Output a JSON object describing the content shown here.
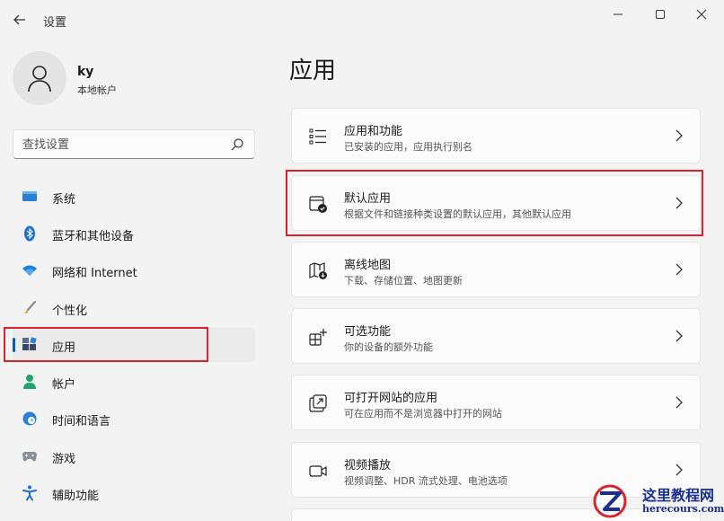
{
  "window": {
    "title": "设置",
    "back_icon": "arrow-left-icon",
    "controls": [
      "minimize-icon",
      "maximize-icon",
      "close-icon"
    ]
  },
  "profile": {
    "name": "ky",
    "account_type": "本地帐户"
  },
  "search": {
    "placeholder": "查找设置"
  },
  "nav": {
    "items": [
      {
        "label": "系统",
        "icon": "monitor-icon"
      },
      {
        "label": "蓝牙和其他设备",
        "icon": "bluetooth-icon"
      },
      {
        "label": "网络和 Internet",
        "icon": "wifi-icon"
      },
      {
        "label": "个性化",
        "icon": "brush-icon"
      },
      {
        "label": "应用",
        "icon": "apps-icon",
        "active": true
      },
      {
        "label": "帐户",
        "icon": "person-icon"
      },
      {
        "label": "时间和语言",
        "icon": "globe-clock-icon"
      },
      {
        "label": "游戏",
        "icon": "gamepad-icon"
      },
      {
        "label": "辅助功能",
        "icon": "accessibility-icon"
      }
    ]
  },
  "main": {
    "title": "应用",
    "cards": [
      {
        "title": "应用和功能",
        "subtitle": "已安装的应用，应用执行别名",
        "icon": "list-icon"
      },
      {
        "title": "默认应用",
        "subtitle": "根据文件和链接种类设置的默认应用，其他默认应用",
        "icon": "default-app-icon"
      },
      {
        "title": "离线地图",
        "subtitle": "下载、存储位置、地图更新",
        "icon": "map-download-icon"
      },
      {
        "title": "可选功能",
        "subtitle": "你的设备的额外功能",
        "icon": "grid-add-icon"
      },
      {
        "title": "可打开网站的应用",
        "subtitle": "可在应用而不是浏览器中打开的网站",
        "icon": "open-external-icon"
      },
      {
        "title": "视频播放",
        "subtitle": "视频调整、HDR 流式处理、电池选项",
        "icon": "video-icon"
      }
    ]
  },
  "colors": {
    "accent": "#005fb8",
    "highlight": "#d9232f"
  },
  "watermark": {
    "text": "这里教程网",
    "url": "herecours.com"
  }
}
